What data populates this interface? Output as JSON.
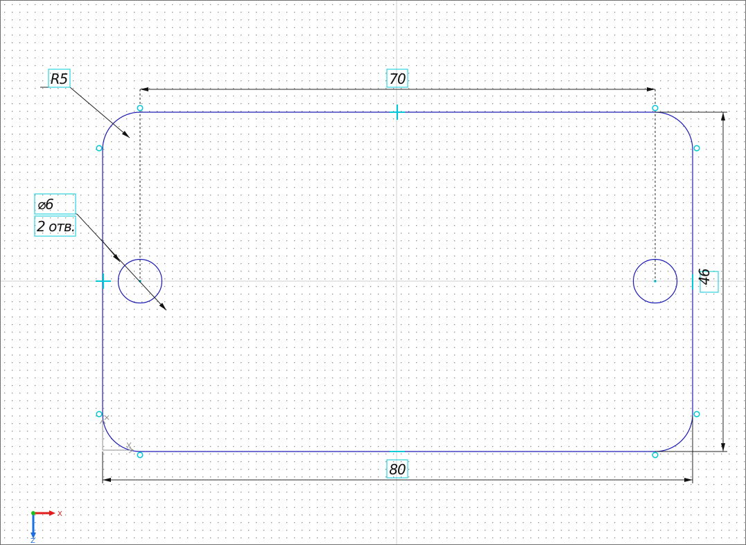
{
  "viewport": {
    "colors": {
      "background": "#ffffff",
      "grid_dots": "#8a8a8a",
      "contour": "#1a1ab5",
      "dimension_line": "#222222",
      "handle": "#00c8d8",
      "origin_marker": "#8c8c8c"
    }
  },
  "dimensions": {
    "radius": {
      "label": "R5"
    },
    "hole_diameter": {
      "label": "⌀6",
      "note": "2 отв."
    },
    "top_width": {
      "label": "70"
    },
    "bottom_width": {
      "label": "80"
    },
    "height": {
      "label": "46"
    }
  },
  "axis_triad": {
    "x_label": "X",
    "z_label": "Z",
    "x_color": "#e21b1b",
    "y_color": "#1bbf1b",
    "z_color": "#1b6fe2"
  }
}
